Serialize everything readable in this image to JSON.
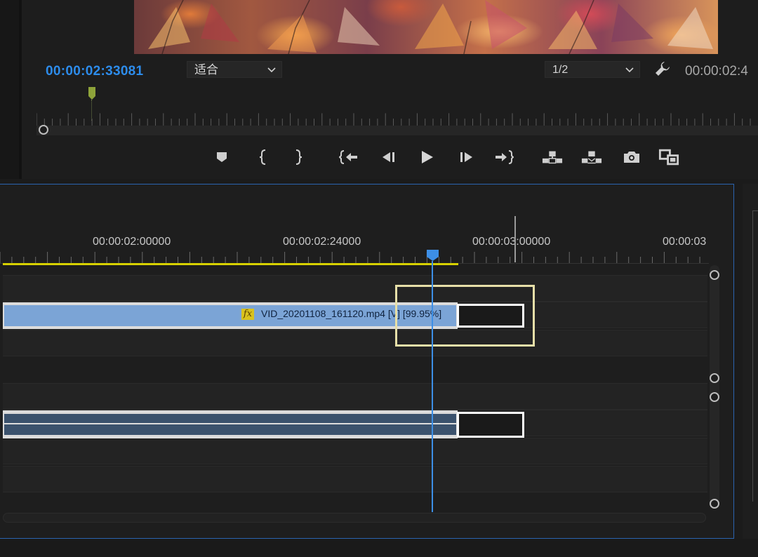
{
  "program_monitor": {
    "current_timecode": "00:00:02:33081",
    "fit_dropdown": {
      "value": "适合",
      "icon": "chevron-down-icon"
    },
    "resolution_dropdown": {
      "value": "1/2",
      "icon": "chevron-down-icon"
    },
    "settings_icon": "wrench-icon",
    "duration_timecode": "00:00:02:4",
    "transport_buttons": [
      {
        "name": "add-marker-button",
        "icon": "marker-icon"
      },
      {
        "name": "mark-in-button",
        "icon": "mark-in-icon"
      },
      {
        "name": "mark-out-button",
        "icon": "mark-out-icon"
      },
      {
        "name": "go-to-in-button",
        "icon": "go-to-in-icon"
      },
      {
        "name": "step-back-button",
        "icon": "step-back-icon"
      },
      {
        "name": "play-button",
        "icon": "play-icon"
      },
      {
        "name": "step-forward-button",
        "icon": "step-forward-icon"
      },
      {
        "name": "go-to-out-button",
        "icon": "go-to-out-icon"
      },
      {
        "name": "lift-button",
        "icon": "lift-icon"
      },
      {
        "name": "extract-button",
        "icon": "extract-icon"
      },
      {
        "name": "export-frame-button",
        "icon": "camera-icon"
      },
      {
        "name": "comparison-view-button",
        "icon": "comparison-icon"
      }
    ]
  },
  "timeline": {
    "ruler_labels": [
      "00:00:02:00000",
      "00:00:02:24000",
      "00:00:03:00000",
      "00:00:03"
    ],
    "video_clip": {
      "fx_label": "fx",
      "name": "VID_20201108_161120.mp4 [V] [99.95%]"
    },
    "colors": {
      "playhead": "#3d8fe6",
      "work_area": "#d7d100",
      "video_clip": "#7ba4d6",
      "audio_clip": "#3b526d",
      "highlight": "#e6dfa8"
    }
  }
}
